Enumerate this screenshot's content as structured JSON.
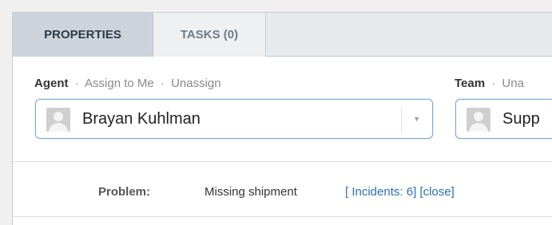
{
  "tabs": [
    {
      "label": "PROPERTIES"
    },
    {
      "label": "TASKS (0)"
    }
  ],
  "agent": {
    "label": "Agent",
    "separator": "·",
    "assign_to_me": "Assign to Me",
    "unassign": "Unassign",
    "value": "Brayan Kuhlman"
  },
  "team": {
    "label": "Team",
    "separator": "·",
    "partial_link": "Una",
    "value": "Supp"
  },
  "problem": {
    "label": "Problem:",
    "value": "Missing shipment",
    "bracket_open": "[",
    "incidents_link": "Incidents: 6",
    "bracket_mid": "]",
    "bracket_open2": "[",
    "close_link": "close",
    "bracket_close": "]"
  },
  "colors": {
    "active_tab_bg": "#ccd3db",
    "link": "#2f6fb6",
    "select_border": "#7aa7d8"
  },
  "icons": {
    "avatar": "user-avatar-placeholder",
    "dropdown": "chevron-down-icon"
  }
}
